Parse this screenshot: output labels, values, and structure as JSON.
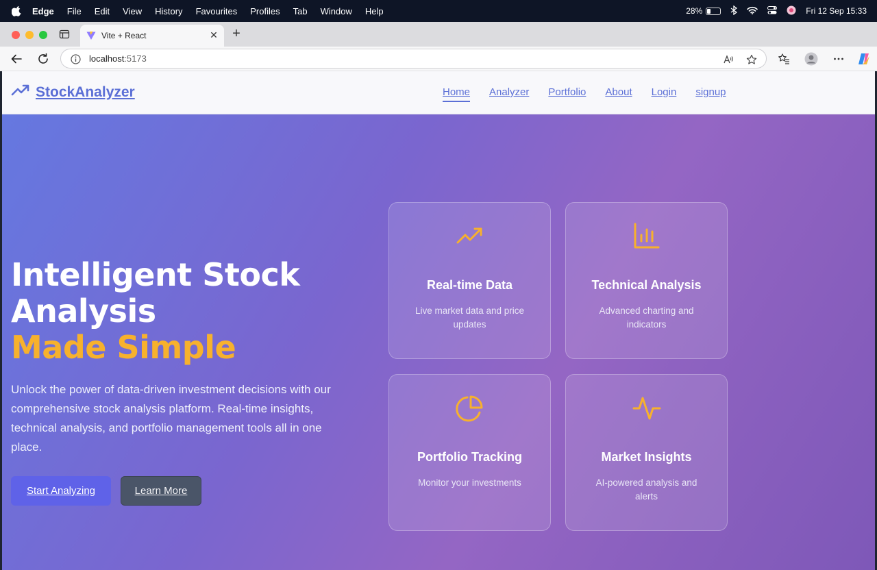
{
  "menubar": {
    "items": [
      "Edge",
      "File",
      "Edit",
      "View",
      "History",
      "Favourites",
      "Profiles",
      "Tab",
      "Window",
      "Help"
    ],
    "battery": "28%",
    "battery_level": 0.28,
    "datetime": "Fri 12 Sep  15:33"
  },
  "browser": {
    "tab_title": "Vite + React",
    "url_host": "localhost",
    "url_port": ":5173"
  },
  "site": {
    "logo": "StockAnalyzer",
    "nav": [
      "Home",
      "Analyzer",
      "Portfolio",
      "About",
      "Login",
      "signup"
    ],
    "active_nav": "Home"
  },
  "hero": {
    "headline_line1": "Intelligent Stock",
    "headline_line2": "Analysis",
    "headline_accent": "Made Simple",
    "subtext": "Unlock the power of data-driven investment decisions with our comprehensive stock analysis platform. Real-time insights, technical analysis, and portfolio management tools all in one place.",
    "primary_button": "Start Analyzing",
    "secondary_button": "Learn More"
  },
  "features": [
    {
      "icon": "trending-up-icon",
      "title": "Real-time Data",
      "desc": "Live market data and price updates"
    },
    {
      "icon": "bar-chart-icon",
      "title": "Technical Analysis",
      "desc": "Advanced charting and indicators"
    },
    {
      "icon": "pie-chart-icon",
      "title": "Portfolio Tracking",
      "desc": "Monitor your investments"
    },
    {
      "icon": "activity-icon",
      "title": "Market Insights",
      "desc": "AI-powered analysis and alerts"
    }
  ],
  "colors": {
    "accent": "#f7b12d",
    "brand": "#5b6fd6",
    "primary_button": "#5f62e8"
  }
}
